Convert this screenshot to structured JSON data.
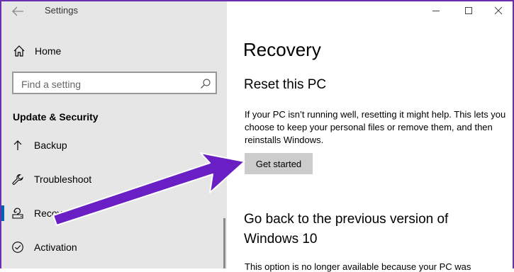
{
  "window": {
    "app_title": "Settings"
  },
  "sidebar": {
    "home_label": "Home",
    "search_placeholder": "Find a setting",
    "section_title": "Update & Security",
    "items": [
      {
        "label": "Backup",
        "icon": "up-arrow-icon"
      },
      {
        "label": "Troubleshoot",
        "icon": "wrench-icon"
      },
      {
        "label": "Recovery",
        "icon": "recovery-icon",
        "selected": true
      },
      {
        "label": "Activation",
        "icon": "checkmark-circle-icon"
      }
    ]
  },
  "main": {
    "page_title": "Recovery",
    "reset": {
      "heading": "Reset this PC",
      "description": "If your PC isn’t running well, resetting it might help. This lets you choose to keep your personal files or remove them, and then reinstalls Windows.",
      "button_label": "Get started"
    },
    "go_back": {
      "heading": "Go back to the previous version of Windows 10",
      "description_partial": "This option is no longer available because your PC was"
    }
  },
  "colors": {
    "sidebar_bg": "#e6e6e6",
    "selection_accent": "#0063b1",
    "button_bg": "#cccccc",
    "annotation_arrow": "#6a1fc4"
  }
}
